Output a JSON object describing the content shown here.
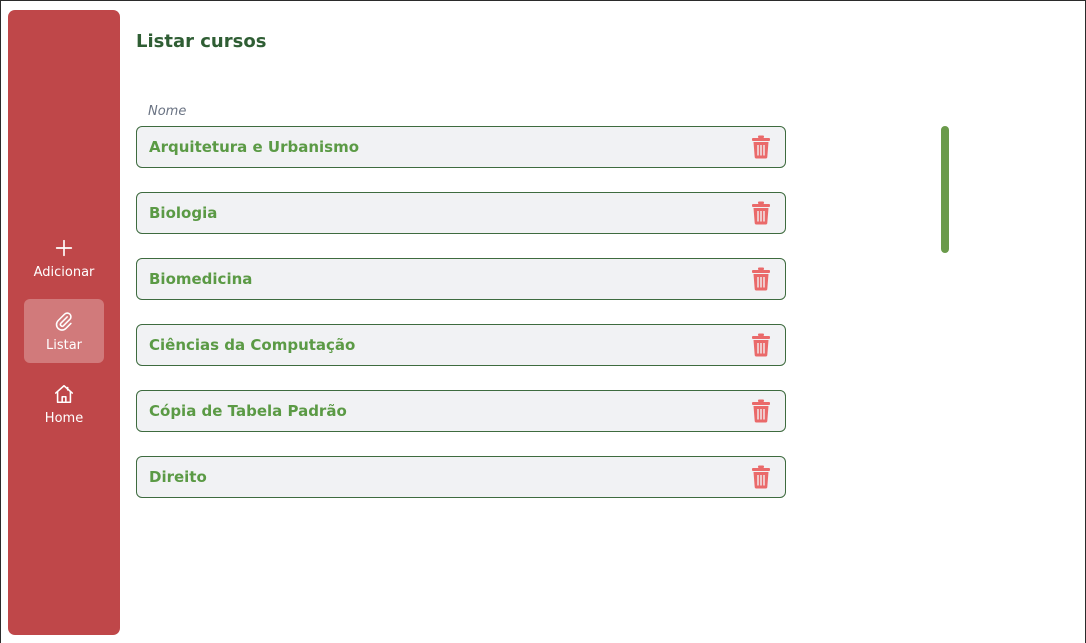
{
  "sidebar": {
    "items": [
      {
        "label": "Adicionar",
        "icon": "plus-icon",
        "active": false
      },
      {
        "label": "Listar",
        "icon": "paperclip-icon",
        "active": true
      },
      {
        "label": "Home",
        "icon": "home-icon",
        "active": false
      }
    ]
  },
  "main": {
    "title": "Listar cursos",
    "column_label": "Nome",
    "courses": [
      {
        "name": "Arquitetura e Urbanismo",
        "action_icon": "trash-icon"
      },
      {
        "name": "Biologia",
        "action_icon": "trash-icon"
      },
      {
        "name": "Biomedicina",
        "action_icon": "trash-icon"
      },
      {
        "name": "Ciências da Computação",
        "action_icon": "trash-icon"
      },
      {
        "name": "Cópia de Tabela Padrão",
        "action_icon": "trash-icon"
      },
      {
        "name": "Direito",
        "action_icon": "trash-icon"
      }
    ]
  },
  "colors": {
    "sidebar_bg": "#bf4749",
    "title": "#2f5e34",
    "course_text": "#5b9a45",
    "row_border": "#3e6b3f",
    "row_bg": "#f1f2f4",
    "trash": "#ea6a6a",
    "scrollbar": "#6a9a4a"
  }
}
